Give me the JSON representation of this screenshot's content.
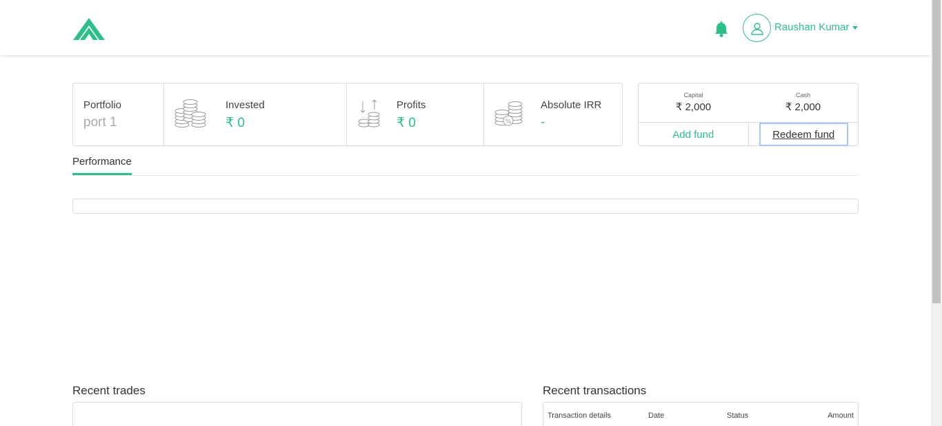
{
  "header": {
    "user_name": "Raushan Kumar",
    "accent_color": "#2dbf8a",
    "icons": [
      "logo-icon",
      "bell-icon",
      "user-icon",
      "caret-down-icon"
    ]
  },
  "stats": {
    "portfolio_label": "Portfolio",
    "portfolio_value": "port 1",
    "invested_label": "Invested",
    "invested_value": "₹ 0",
    "profits_label": "Profits",
    "profits_value": "₹ 0",
    "irr_label": "Absolute IRR",
    "irr_value": "-"
  },
  "fund": {
    "capital_label": "Capital",
    "capital_value": "₹ 2,000",
    "cash_label": "Cash",
    "cash_value": "₹ 2,000",
    "add_label": "Add fund",
    "redeem_label": "Redeem fund"
  },
  "tabs": {
    "performance": "Performance"
  },
  "recent_trades": {
    "title": "Recent trades"
  },
  "recent_transactions": {
    "title": "Recent transactions",
    "columns": [
      "Transaction details",
      "Date",
      "Status",
      "Amount"
    ]
  }
}
